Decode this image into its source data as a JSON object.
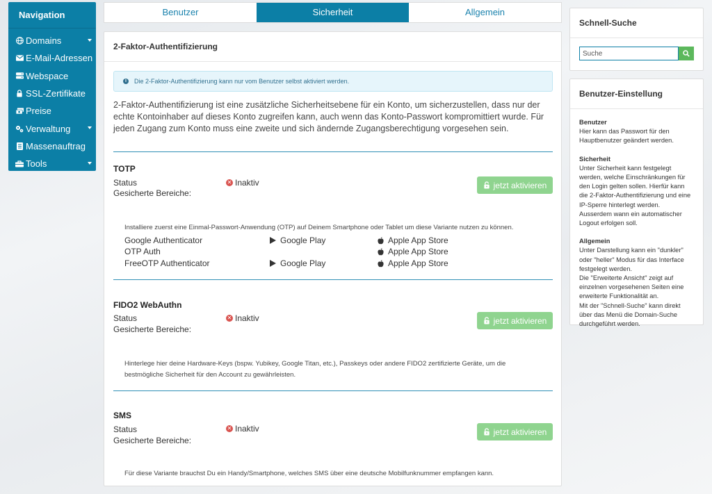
{
  "sidebar": {
    "title": "Navigation",
    "items": [
      {
        "label": "Domains",
        "icon": "globe-icon",
        "has_caret": true
      },
      {
        "label": "E-Mail-Adressen",
        "icon": "envelope-icon",
        "has_caret": false
      },
      {
        "label": "Webspace",
        "icon": "server-icon",
        "has_caret": false
      },
      {
        "label": "SSL-Zertifikate",
        "icon": "lock-icon",
        "has_caret": false
      },
      {
        "label": "Preise",
        "icon": "money-icon",
        "has_caret": false
      },
      {
        "label": "Verwaltung",
        "icon": "cogs-icon",
        "has_caret": true
      },
      {
        "label": "Massenauftrag",
        "icon": "list-icon",
        "has_caret": false
      },
      {
        "label": "Tools",
        "icon": "toolbox-icon",
        "has_caret": true
      }
    ]
  },
  "tabs": [
    {
      "label": "Benutzer",
      "active": false
    },
    {
      "label": "Sicherheit",
      "active": true
    },
    {
      "label": "Allgemein",
      "active": false
    }
  ],
  "panel": {
    "title": "2-Faktor-Authentifizierung",
    "info": "Die 2-Faktor-Authentifizierung kann nur vom Benutzer selbst aktiviert werden.",
    "intro": "2-Faktor-Authentifizierung ist eine zusätzliche Sicherheitsebene für ein Konto, um sicherzustellen, dass nur der echte Kontoinhaber auf dieses Konto zugreifen kann, auch wenn das Konto-Passwort kompromittiert wurde. Für jeden Zugang zum Konto muss eine zweite und sich ändernde Zugangsberechtigung vorgesehen sein.",
    "status_label": "Status",
    "areas_label": "Gesicherte Bereiche:",
    "inactive_label": "Inaktiv",
    "activate_label": "jetzt aktivieren",
    "totp": {
      "title": "TOTP",
      "description": "Installiere zuerst eine Einmal-Passwort-Anwendung (OTP) auf Deinem Smartphone oder Tablet um diese Variante nutzen zu können.",
      "apps": [
        {
          "name": "Google Authenticator",
          "google_play": "Google Play",
          "app_store": "Apple App Store"
        },
        {
          "name": "OTP Auth",
          "google_play": "",
          "app_store": "Apple App Store"
        },
        {
          "name": "FreeOTP Authenticator",
          "google_play": "Google Play",
          "app_store": "Apple App Store"
        }
      ]
    },
    "fido": {
      "title": "FIDO2 WebAuthn",
      "description": "Hinterlege hier deine Hardware-Keys (bspw. Yubikey, Google Titan, etc.), Passkeys oder andere FIDO2 zertifizierte Geräte, um die bestmögliche Sicherheit für den Account zu gewährleisten."
    },
    "sms": {
      "title": "SMS",
      "description": "Für diese Variante brauchst Du ein Handy/Smartphone, welches SMS über eine deutsche Mobilfunknummer empfangen kann."
    }
  },
  "quick_search": {
    "title": "Schnell-Suche",
    "placeholder": "Suche"
  },
  "user_settings": {
    "title": "Benutzer-Einstellung",
    "sections": [
      {
        "heading": "Benutzer",
        "lines": [
          "Hier kann das Passwort für den Hauptbenutzer geändert werden."
        ]
      },
      {
        "heading": "Sicherheit",
        "lines": [
          "Unter Sicherheit kann festgelegt werden, welche Einschränkungen für den Login gelten sollen. Hierfür kann die 2-Faktor-Authentifizierung und eine IP-Sperre hinterlegt werden. Ausserdem wann ein automatischer Logout erfolgen soll."
        ]
      },
      {
        "heading": "Allgemein",
        "lines": [
          "Unter Darstellung kann ein \"dunkler\" oder \"heller\" Modus für das Interface festgelegt werden.",
          "Die \"Erweiterte Ansicht\" zeigt auf einzelnen vorgesehenen Seiten eine erweiterte Funktionalität an.",
          "Mit der \"Schnell-Suche\" kann direkt über das Menü die Domain-Suche durchgeführt werden."
        ]
      }
    ]
  },
  "colors": {
    "primary": "#0c7fa6",
    "success_disabled": "#8fd48f",
    "danger": "#d9534f",
    "info_bg": "#e6f5fb"
  }
}
